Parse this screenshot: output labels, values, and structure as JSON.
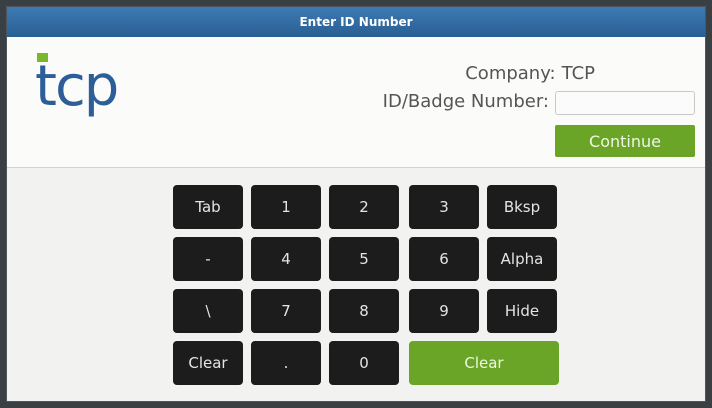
{
  "window": {
    "title": "Enter ID Number"
  },
  "logo": {
    "text": "tcp"
  },
  "company": {
    "label": "Company:",
    "value": "TCP"
  },
  "id_field": {
    "label": "ID/Badge Number:",
    "value": ""
  },
  "continue_label": "Continue",
  "keypad": {
    "tab": "Tab",
    "k1": "1",
    "k2": "2",
    "k3": "3",
    "bksp": "Bksp",
    "dash": "-",
    "k4": "4",
    "k5": "5",
    "k6": "6",
    "alpha": "Alpha",
    "backslash": "\\",
    "k7": "7",
    "k8": "8",
    "k9": "9",
    "hide": "Hide",
    "clear_small": "Clear",
    "dot": ".",
    "k0": "0",
    "clear_big": "Clear"
  },
  "colors": {
    "brand_blue": "#2e5e97",
    "brand_green": "#6aa527",
    "key_dark": "#1c1c1c"
  }
}
